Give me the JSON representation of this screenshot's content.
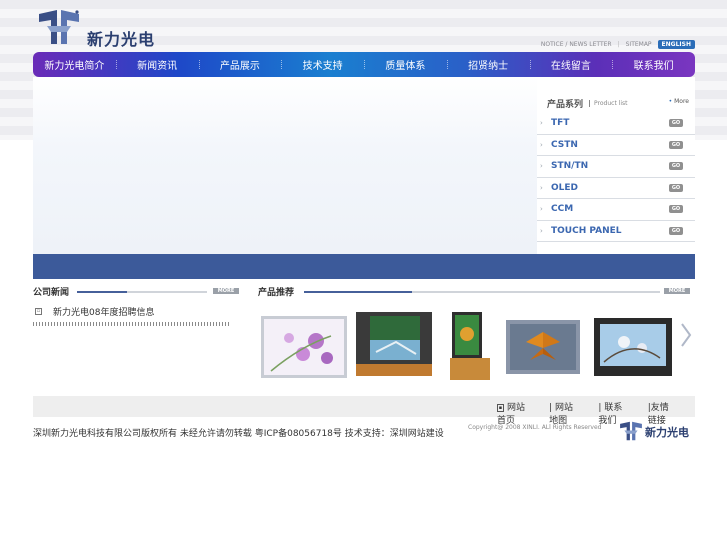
{
  "header": {
    "logo_text": "新力光电",
    "top_links": [
      "NOTICE / NEWS LETTER",
      "SITEMAP"
    ],
    "lang_button": "ENGLISH"
  },
  "nav": {
    "items": [
      "新力光电简介",
      "新闻资讯",
      "产品展示",
      "技术支持",
      "质量体系",
      "招贤纳士",
      "在线留言",
      "联系我们"
    ]
  },
  "product_panel": {
    "title": "产品系列",
    "subtitle": "Product list",
    "more": "More",
    "go_label": "GO",
    "items": [
      "TFT",
      "CSTN",
      "STN/TN",
      "OLED",
      "CCM",
      "TOUCH PANEL"
    ]
  },
  "news": {
    "title": "公司新闻",
    "more": "MORE",
    "items": [
      "新力光电08年度招聘信息"
    ]
  },
  "products": {
    "title": "产品推荐",
    "more": "MORE"
  },
  "footer": {
    "links": [
      "网站首页",
      "网站地图",
      "联系我们",
      "友情链接"
    ],
    "text": "深圳新力光电科技有限公司版权所有 未经允许请勿转载 粤ICP备08056718号 技术支持：深圳网站建设",
    "copyright": "Copyright@ 2008 XINLI. ALl Rights Reserved",
    "logo_text": "新力光电"
  },
  "colors": {
    "accent": "#3c5a9a",
    "link": "#3b67b0",
    "brand": "#2b3f70"
  }
}
